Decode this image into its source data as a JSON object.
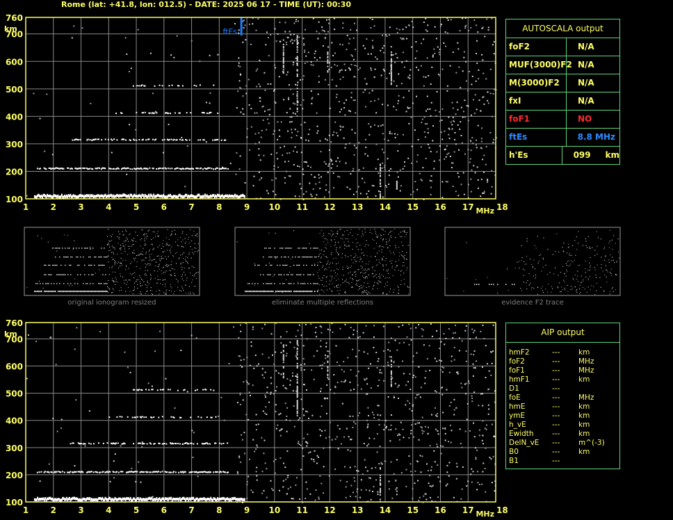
{
  "header": {
    "title": "Rome (lat: +41.8, lon: 012.5) - DATE: 2025 06 17 - TIME (UT): 00:30"
  },
  "colors": {
    "axis": "#ffff66",
    "grid": "#8a8a8a",
    "panel_border": "#5fd87a",
    "ftes_marker": "#1e7cff",
    "fof1": "#ff2a2a",
    "ftes_text": "#2a8cff"
  },
  "autoscala": {
    "title": "AUTOSCALA output",
    "rows": [
      {
        "name": "foF2",
        "value": "N/A",
        "color": "#ffff66"
      },
      {
        "name": "MUF(3000)F2",
        "value": "N/A",
        "color": "#ffff66"
      },
      {
        "name": "M(3000)F2",
        "value": "N/A",
        "color": "#ffff66"
      },
      {
        "name": "fxI",
        "value": "N/A",
        "color": "#ffff66"
      },
      {
        "name": "foF1",
        "value": "NO",
        "color": "#ff2a2a"
      },
      {
        "name": "ftEs",
        "value": "8.8 MHz",
        "color": "#2a8cff"
      },
      {
        "name": "h'Es",
        "value": "099     km",
        "color": "#ffff66"
      }
    ]
  },
  "aip": {
    "title": "AIP output",
    "rows": [
      {
        "name": "hmF2",
        "value": "---",
        "unit": "km"
      },
      {
        "name": "foF2",
        "value": "---",
        "unit": "MHz"
      },
      {
        "name": "foF1",
        "value": "---",
        "unit": "MHz"
      },
      {
        "name": "hmF1",
        "value": "---",
        "unit": "km"
      },
      {
        "name": "D1",
        "value": "---",
        "unit": ""
      },
      {
        "name": "foE",
        "value": "---",
        "unit": "MHz"
      },
      {
        "name": "hmE",
        "value": "---",
        "unit": "km"
      },
      {
        "name": "ymE",
        "value": "---",
        "unit": "km"
      },
      {
        "name": "h_vE",
        "value": "---",
        "unit": "km"
      },
      {
        "name": "Ewidth",
        "value": "---",
        "unit": "km"
      },
      {
        "name": "DelN_vE",
        "value": "---",
        "unit": "m^(-3)"
      },
      {
        "name": "B0",
        "value": "---",
        "unit": "km"
      },
      {
        "name": "B1",
        "value": "---",
        "unit": ""
      }
    ]
  },
  "thumbnails": [
    {
      "caption": "original ionogram resized"
    },
    {
      "caption": "eliminate multiple reflections"
    },
    {
      "caption": "evidence F2 trace"
    }
  ],
  "chart_data": [
    {
      "type": "scatter",
      "panel": "top",
      "xlabel": "MHz",
      "ylabel": "km",
      "xlim": [
        1,
        18
      ],
      "ylim": [
        100,
        760
      ],
      "x_ticks": [
        "1",
        "2",
        "3",
        "4",
        "5",
        "6",
        "7",
        "8",
        "9",
        "10",
        "11",
        "12",
        "13",
        "14",
        "15",
        "16",
        "17",
        "18"
      ],
      "y_ticks": [
        "100",
        "200",
        "300",
        "400",
        "500",
        "600",
        "700",
        "760"
      ],
      "grid": true,
      "marker": {
        "label": "ftEs",
        "x": 8.8
      },
      "traces": [
        {
          "name": "Es",
          "h": 110,
          "f_start": 1.3,
          "f_end": 8.9,
          "density": 1.0
        },
        {
          "name": "2Es",
          "h": 210,
          "f_start": 1.4,
          "f_end": 8.3,
          "density": 0.7
        },
        {
          "name": "3Es",
          "h": 315,
          "f_start": 2.6,
          "f_end": 8.3,
          "density": 0.45
        },
        {
          "name": "4Es",
          "h": 412,
          "f_start": 4.0,
          "f_end": 8.0,
          "density": 0.35
        },
        {
          "name": "5Es",
          "h": 512,
          "f_start": 4.8,
          "f_end": 7.8,
          "density": 0.3
        }
      ]
    },
    {
      "type": "scatter",
      "panel": "bottom",
      "xlabel": "MHz",
      "ylabel": "km",
      "xlim": [
        1,
        18
      ],
      "ylim": [
        100,
        760
      ],
      "x_ticks": [
        "1",
        "2",
        "3",
        "4",
        "5",
        "6",
        "7",
        "8",
        "9",
        "10",
        "11",
        "12",
        "13",
        "14",
        "15",
        "16",
        "17",
        "18"
      ],
      "y_ticks": [
        "100",
        "200",
        "300",
        "400",
        "500",
        "600",
        "700",
        "760"
      ],
      "grid": true,
      "traces": [
        {
          "name": "Es",
          "h": 110,
          "f_start": 1.3,
          "f_end": 8.9,
          "density": 1.0
        },
        {
          "name": "2Es",
          "h": 210,
          "f_start": 1.4,
          "f_end": 8.3,
          "density": 0.7
        },
        {
          "name": "3Es",
          "h": 315,
          "f_start": 2.6,
          "f_end": 8.3,
          "density": 0.45
        },
        {
          "name": "4Es",
          "h": 412,
          "f_start": 4.0,
          "f_end": 8.0,
          "density": 0.35
        },
        {
          "name": "5Es",
          "h": 512,
          "f_start": 4.8,
          "f_end": 7.8,
          "density": 0.3
        }
      ]
    }
  ]
}
